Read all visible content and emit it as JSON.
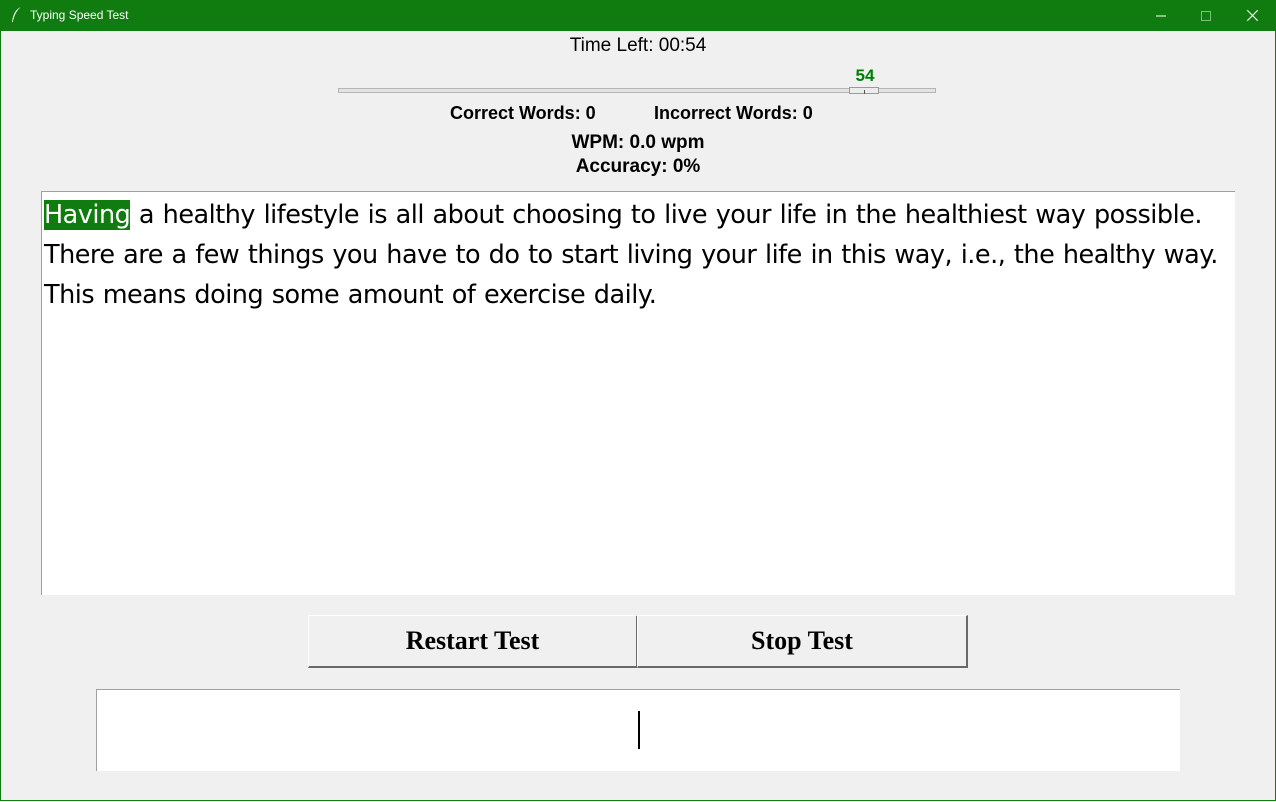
{
  "window": {
    "title": "Typing Speed Test",
    "icon": "feather-icon",
    "accent_color": "#107c10",
    "controls": [
      "minimize-icon",
      "maximize-icon",
      "close-icon"
    ]
  },
  "timer": {
    "label": "Time Left: 00:54",
    "slider_value": "54",
    "slider_value_color": "#008000",
    "slider_fraction": 0.9
  },
  "stats": {
    "correct": "Correct Words: 0",
    "incorrect": "Incorrect Words: 0",
    "wpm": "WPM: 0.0 wpm",
    "accuracy": "Accuracy: 0%"
  },
  "passage": {
    "current_word": "Having",
    "remaining": " a healthy lifestyle is all about choosing to live your life in the healthiest way possible. There are a few things you have to do to start living your life in this way, i.e., the healthy way. This means doing some amount of exercise daily.",
    "highlight_color": "#107c10"
  },
  "buttons": {
    "restart": "Restart Test",
    "stop": "Stop Test"
  },
  "typing_input": {
    "value": ""
  }
}
